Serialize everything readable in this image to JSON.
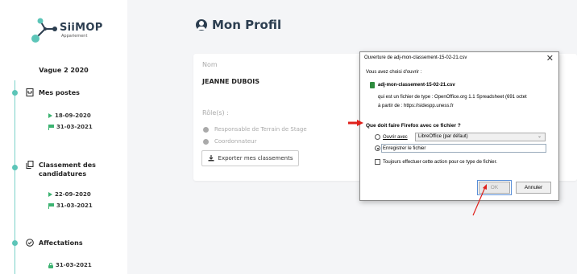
{
  "sidebar": {
    "logo_text": "SiiMOP",
    "logo_sub": "Appariement",
    "vague": "Vague 2 2020",
    "sections": [
      {
        "label": "Mes postes",
        "icon": "document-icon"
      },
      {
        "label": "Classement des candidatures",
        "icon": "files-icon"
      },
      {
        "label": "Affectations",
        "icon": "check-circle-icon"
      }
    ],
    "dates": {
      "postes_1": "18-09-2020",
      "postes_2": "31-03-2021",
      "classement_1": "22-09-2020",
      "classement_2": "31-03-2021",
      "affectations_1": "31-03-2021"
    }
  },
  "main": {
    "title": "Mon Profil",
    "nom_label": "Nom",
    "nom_value": "JEANNE DUBOIS",
    "roles_label": "Rôle(s) :",
    "roles": [
      "Responsable de Terrain de Stage",
      "Coordonnateur"
    ],
    "export_label": "Exporter mes classements"
  },
  "dialog": {
    "title": "Ouverture de adj-mon-classement-15-02-21.csv",
    "close": "✕",
    "intro": "Vous avez choisi d'ouvrir :",
    "filename": "adj-mon-classement-15-02-21.csv",
    "filetype": "qui est un fichier de type : OpenOffice.org 1.1 Spreadsheet (691 octet",
    "source": "à partir de : https://sidespp.uness.fr",
    "question": "Que doit faire Firefox avec ce fichier ?",
    "open_with_label": "Ouvrir avec",
    "open_with_value": "LibreOffice (par défaut)",
    "save_label": "Enregistrer le fichier",
    "always_label": "Toujours effectuer cette action pour ce type de fichier.",
    "ok_label": "OK",
    "cancel_label": "Annuler"
  },
  "colors": {
    "accent": "#5cc5b8",
    "green": "#3cb371",
    "title": "#2c3e50",
    "annotation": "#e0201b"
  }
}
